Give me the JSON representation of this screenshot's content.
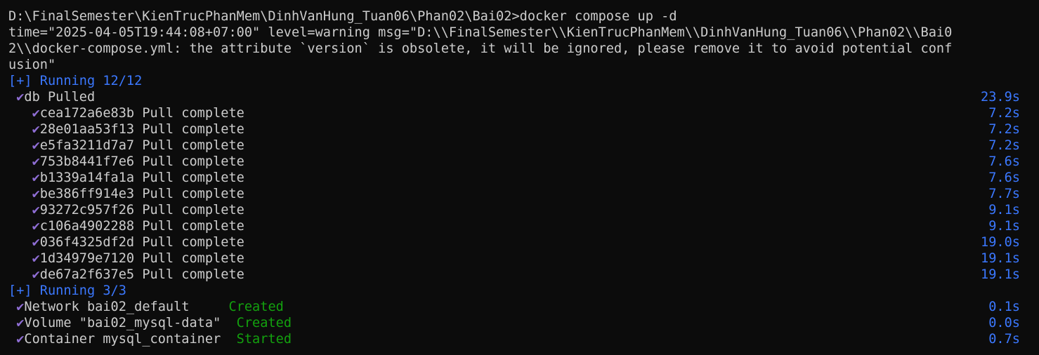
{
  "prompt_line": "D:\\FinalSemester\\KienTrucPhanMem\\DinhVanHung_Tuan06\\Phan02\\Bai02>docker compose up -d",
  "warning_lines": [
    "time=\"2025-04-05T19:44:08+07:00\" level=warning msg=\"D:\\\\FinalSemester\\\\KienTrucPhanMem\\\\DinhVanHung_Tuan06\\\\Phan02\\\\Bai0",
    "2\\\\docker-compose.yml: the attribute `version` is obsolete, it will be ignored, please remove it to avoid potential conf",
    "usion\""
  ],
  "section1": {
    "header": "[+] Running 12/12",
    "db": {
      "text": "db Pulled",
      "time": "23.9s"
    },
    "layers": [
      {
        "text": "cea172a6e83b Pull complete",
        "time": "7.2s"
      },
      {
        "text": "28e01aa53f13 Pull complete",
        "time": "7.2s"
      },
      {
        "text": "e5fa3211d7a7 Pull complete",
        "time": "7.2s"
      },
      {
        "text": "753b8441f7e6 Pull complete",
        "time": "7.6s"
      },
      {
        "text": "b1339a14fa1a Pull complete",
        "time": "7.6s"
      },
      {
        "text": "be386ff914e3 Pull complete",
        "time": "7.7s"
      },
      {
        "text": "93272c957f26 Pull complete",
        "time": "9.1s"
      },
      {
        "text": "c106a4902288 Pull complete",
        "time": "9.1s"
      },
      {
        "text": "036f4325df2d Pull complete",
        "time": "19.0s"
      },
      {
        "text": "1d34979e7120 Pull complete",
        "time": "19.1s"
      },
      {
        "text": "de67a2f637e5 Pull complete",
        "time": "19.1s"
      }
    ]
  },
  "section2": {
    "header": "[+] Running 3/3",
    "items": [
      {
        "name": "Network bai02_default     ",
        "status": "Created",
        "time": "0.1s"
      },
      {
        "name": "Volume \"bai02_mysql-data\"  ",
        "status": "Created",
        "time": "0.0s"
      },
      {
        "name": "Container mysql_container  ",
        "status": "Started",
        "time": "0.7s"
      }
    ]
  },
  "check_glyph": "✔",
  "colors": {
    "background": "#0c0c0c",
    "text": "#cccccc",
    "blue": "#3b78ff",
    "green": "#13a10e",
    "check": "#8f6ed5"
  }
}
